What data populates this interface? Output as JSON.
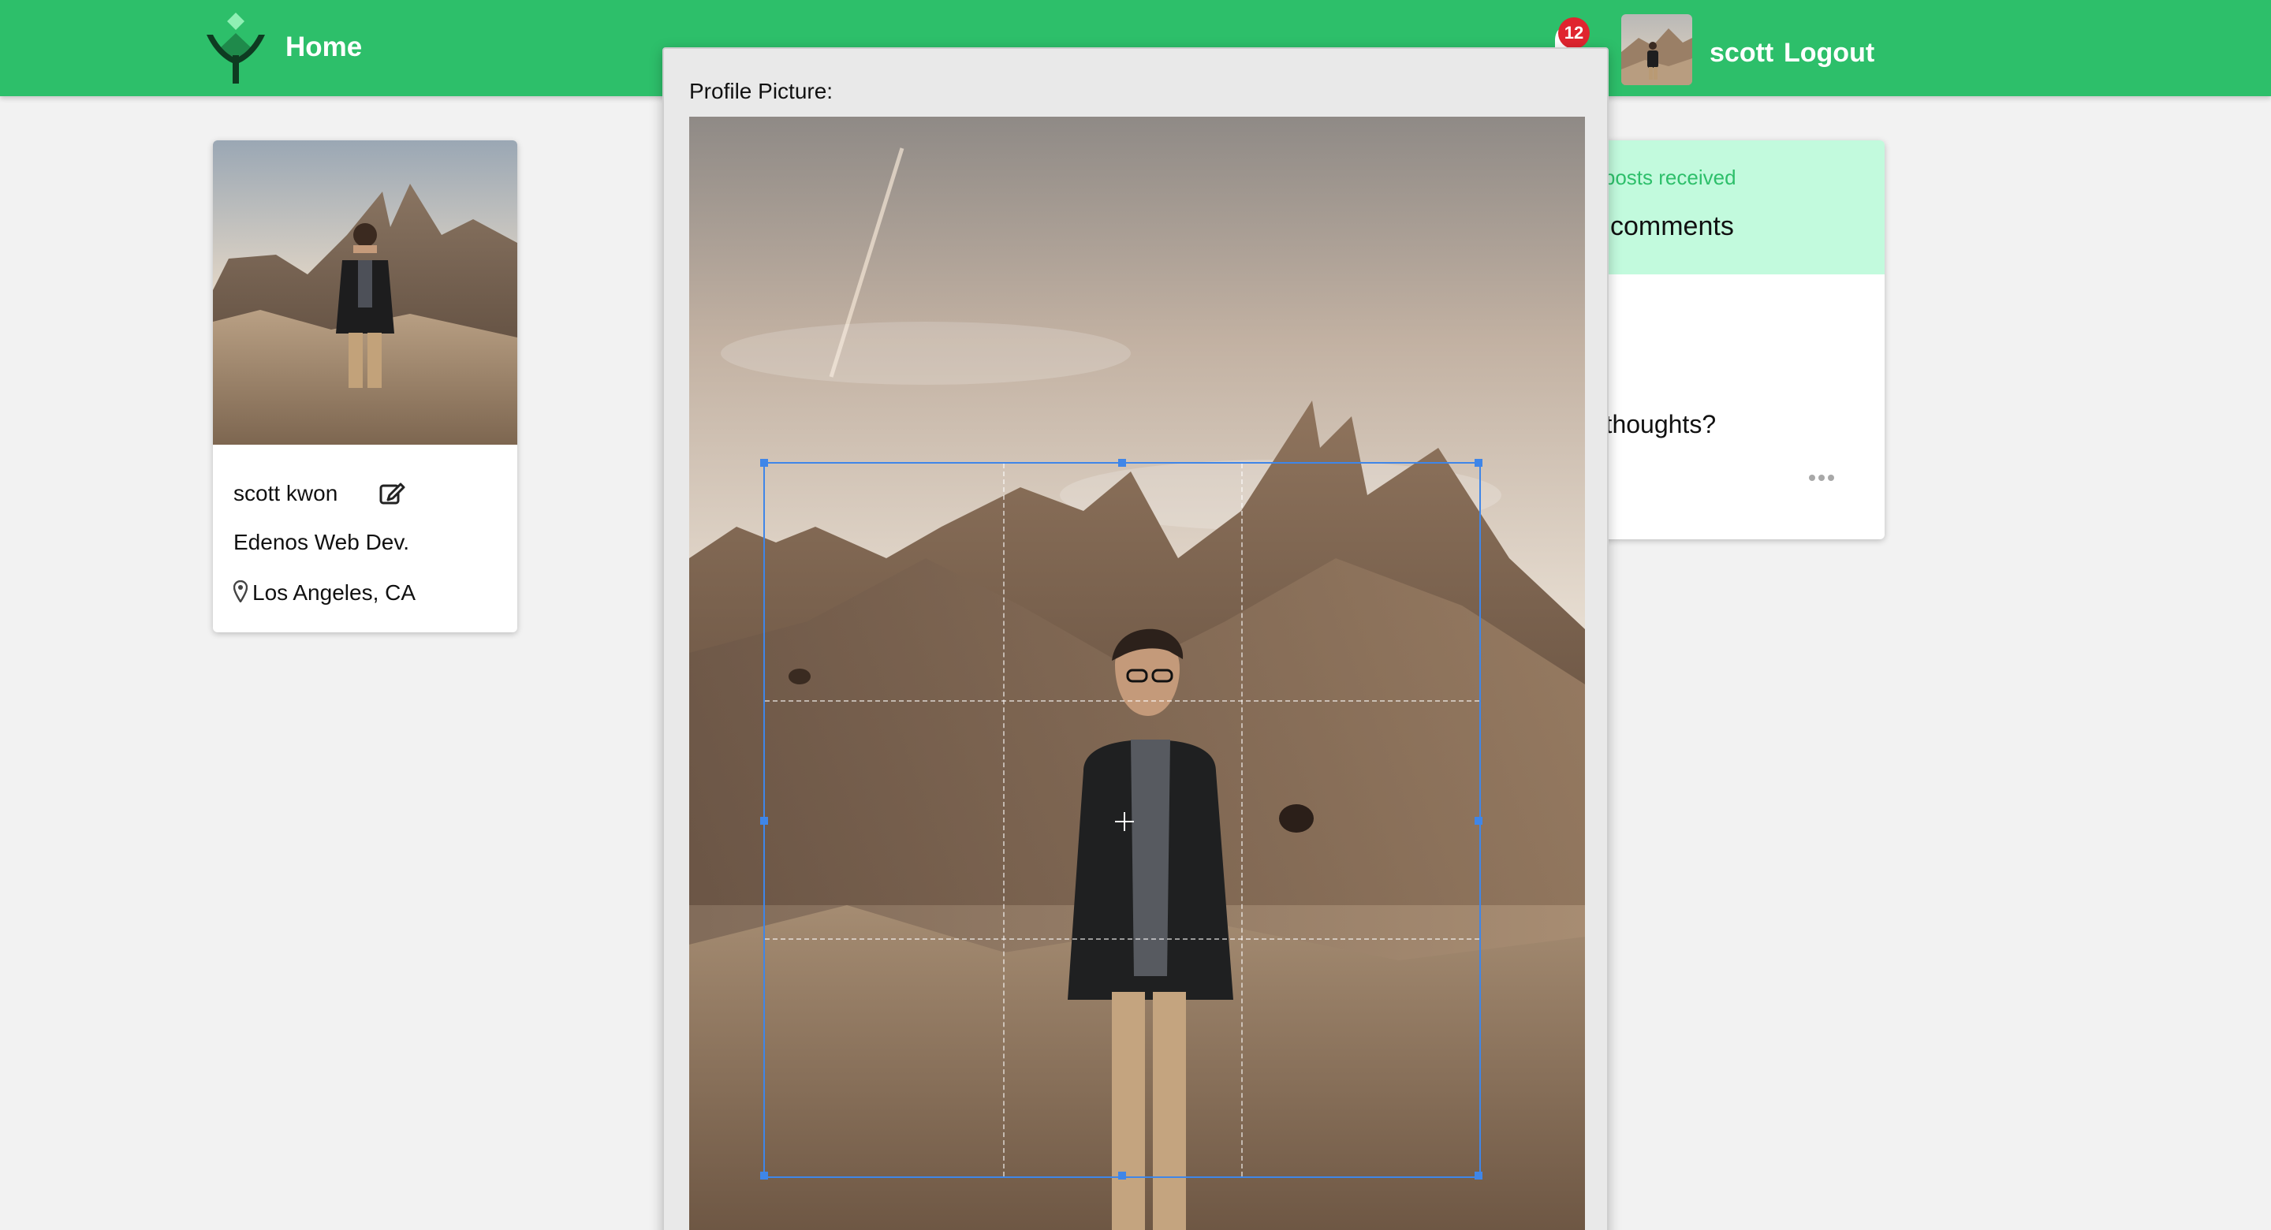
{
  "nav": {
    "home_label": "Home",
    "notification_count": "12",
    "username": "scott",
    "logout_label": "Logout",
    "color": "#2dbf6a"
  },
  "profile": {
    "name": "scott kwon",
    "company": "Edenos Web Dev.",
    "location": "Los Angeles, CA"
  },
  "stats": {
    "caption": "r posts received",
    "value": "comments",
    "thoughts_prompt": "r thoughts?"
  },
  "modal": {
    "title": "Profile Picture:"
  },
  "icons": [
    "logo-icon",
    "bell-icon",
    "edit-icon",
    "map-pin-icon",
    "more-icon",
    "crosshair-icon"
  ]
}
